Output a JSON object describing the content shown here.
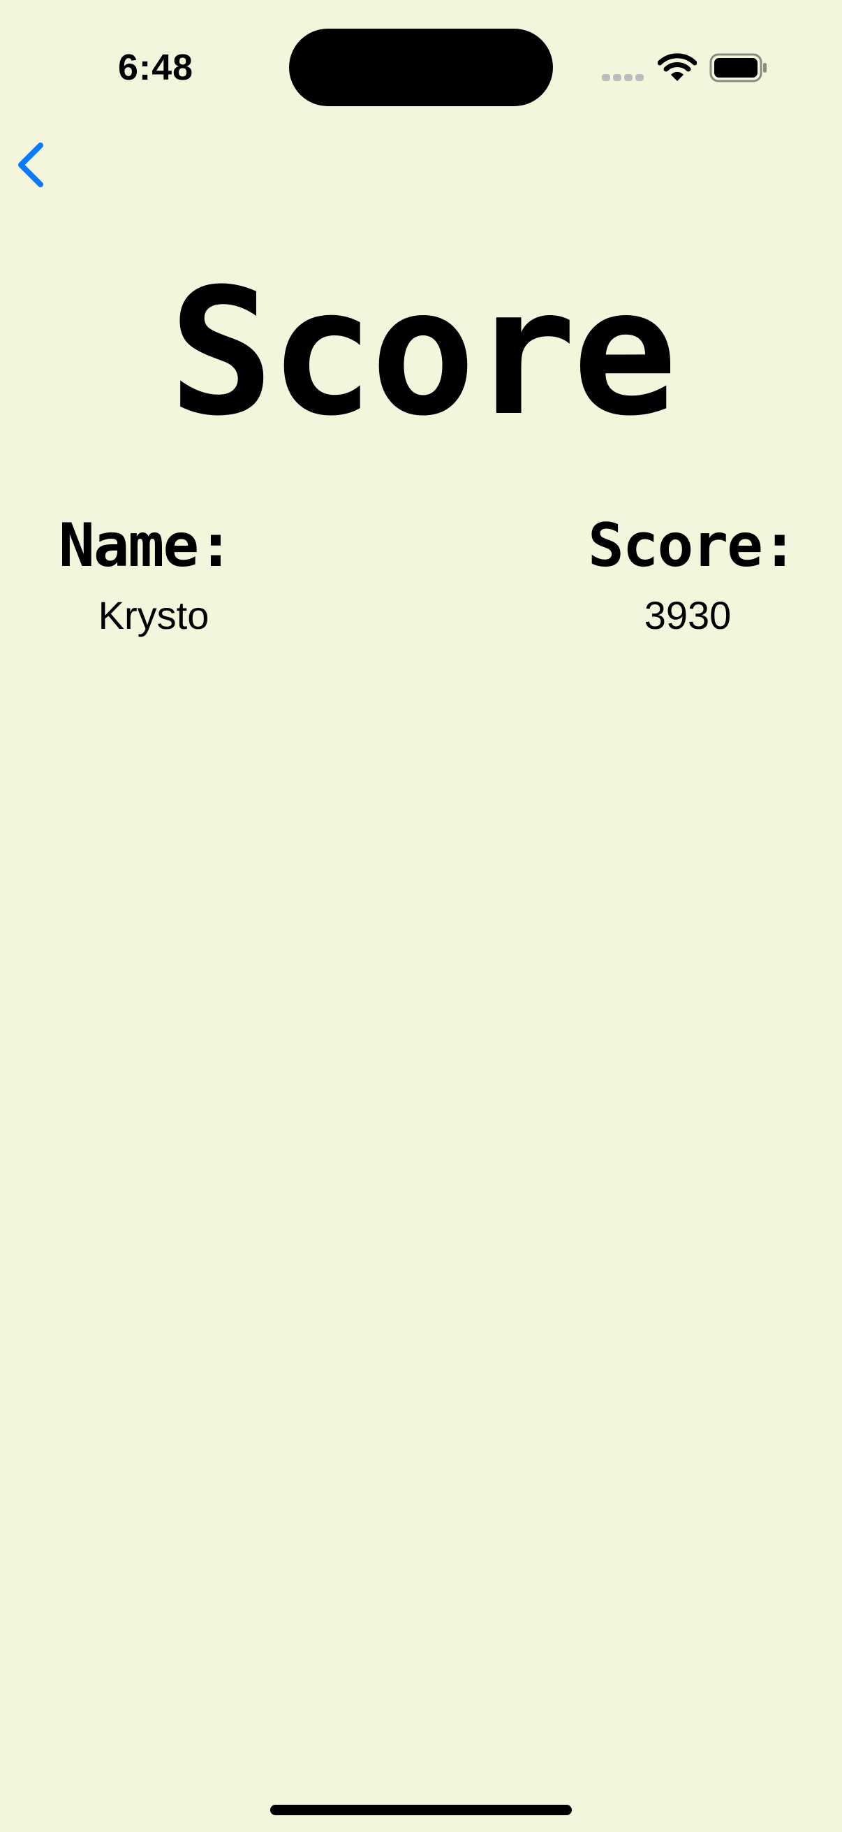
{
  "status_bar": {
    "time": "6:48",
    "icons": [
      "cellular-signal-icon",
      "wifi-icon",
      "battery-icon"
    ]
  },
  "nav": {
    "back_icon": "chevron-left-icon"
  },
  "page": {
    "title": "Score"
  },
  "table": {
    "columns": [
      "Name:",
      "Score:"
    ],
    "rows": [
      {
        "name": "Krysto",
        "score": "3930"
      }
    ]
  },
  "colors": {
    "background": "#F4F5DD",
    "accent": "#0A7AFF",
    "text": "#000000"
  }
}
